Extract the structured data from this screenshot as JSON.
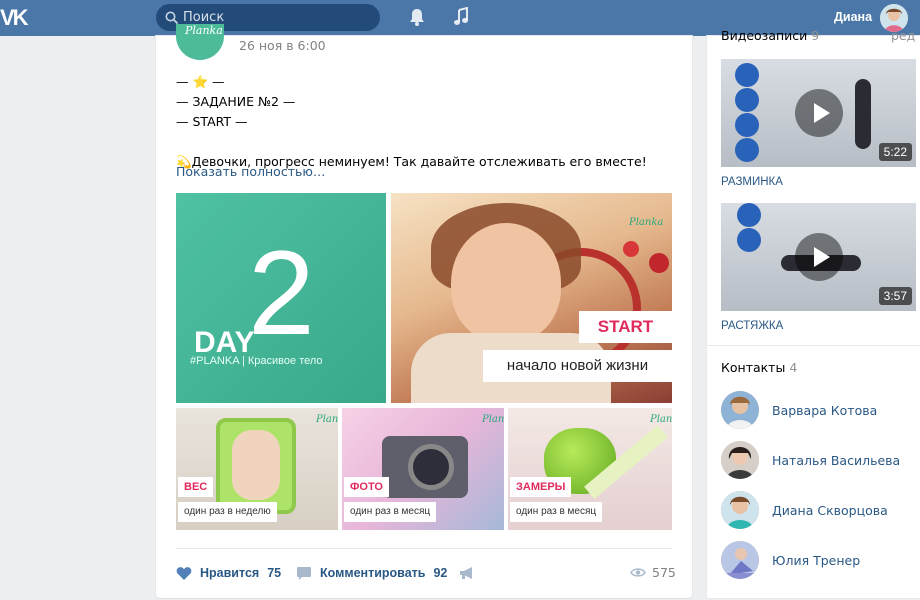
{
  "header": {
    "logo": "VK",
    "search_placeholder": "Поиск",
    "user_name": "Диана"
  },
  "post": {
    "date": "26 ноя в 6:00",
    "group_logo_text": "Planka",
    "text_lines": [
      "— ⭐ —",
      "— ЗАДАНИЕ №2 —",
      "— START —",
      "",
      "💫Девочки, прогресс неминуем! Так давайте отслеживать его вместе!"
    ],
    "show_more": "Показать полностью…",
    "images": {
      "day": {
        "big": "2",
        "day": "DAY",
        "sub": "#PLANKA | Красивое тело"
      },
      "start": {
        "brand": "Planka",
        "label": "START",
        "caption": "начало новой жизни"
      },
      "small": [
        {
          "brand": "Planka",
          "label": "ВЕС",
          "caption": "один раз в неделю"
        },
        {
          "brand": "Planka",
          "label": "ФОТО",
          "caption": "один раз в месяц"
        },
        {
          "brand": "Planka",
          "label": "ЗАМЕРЫ",
          "caption": "один раз в месяц"
        }
      ]
    },
    "actions": {
      "like_label": "Нравится",
      "like_count": "75",
      "comment_label": "Комментировать",
      "comment_count": "92",
      "views": "575"
    }
  },
  "sidebar": {
    "videos_title": "Видеозаписи",
    "videos_count": "9",
    "videos_edit": "ред",
    "videos": [
      {
        "duration": "5:22",
        "title": "РАЗМИНКА"
      },
      {
        "duration": "3:57",
        "title": "РАСТЯЖКА"
      }
    ],
    "contacts_title": "Контакты",
    "contacts_count": "4",
    "contacts": [
      {
        "name": "Варвара Котова"
      },
      {
        "name": "Наталья Васильева"
      },
      {
        "name": "Диана Скворцова"
      },
      {
        "name": "Юлия Тренер"
      }
    ]
  },
  "colors": {
    "header_bg": "#4a76a8",
    "link": "#2a5885",
    "planka_green": "#4fc2a3",
    "accent_pink": "#e02b5c"
  }
}
